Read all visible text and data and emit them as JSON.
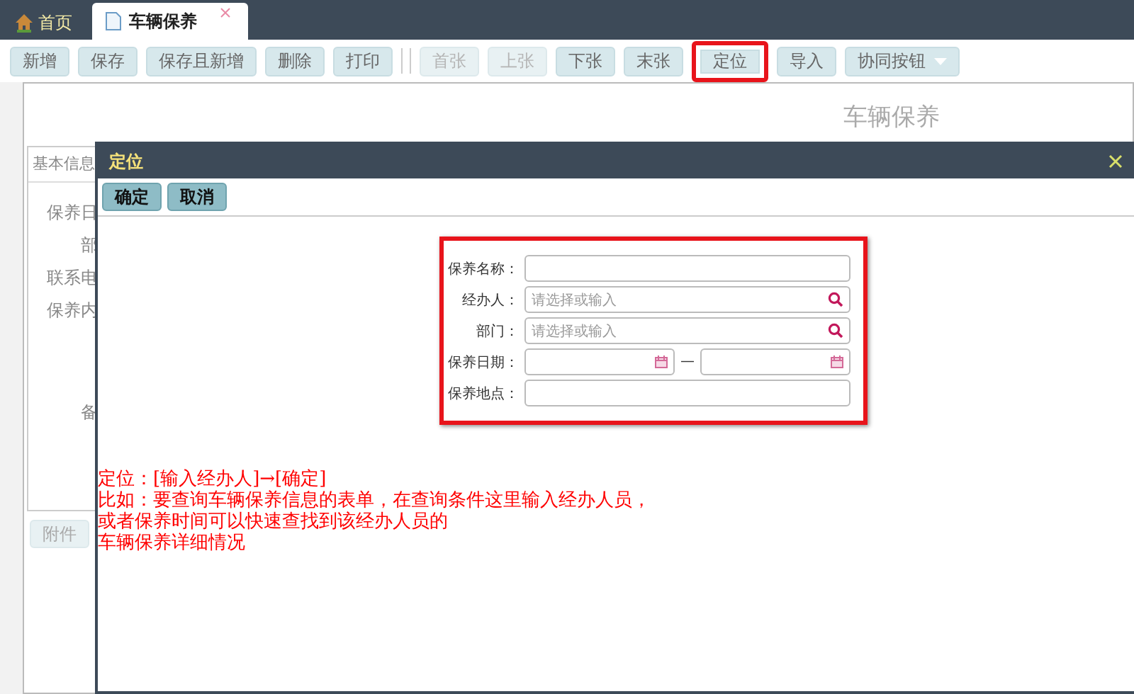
{
  "tabs": [
    {
      "label": "首页",
      "kind": "home",
      "selected": false,
      "closable": false
    },
    {
      "label": "车辆保养",
      "kind": "document",
      "selected": true,
      "closable": true
    }
  ],
  "toolbar": [
    {
      "label": "新增",
      "kind": "button",
      "disabled": false,
      "highlighted": false
    },
    {
      "label": "保存",
      "kind": "button",
      "disabled": false,
      "highlighted": false
    },
    {
      "label": "保存且新增",
      "kind": "button",
      "disabled": false,
      "highlighted": false
    },
    {
      "label": "删除",
      "kind": "button",
      "disabled": false,
      "highlighted": false
    },
    {
      "label": "打印",
      "kind": "button",
      "disabled": false,
      "highlighted": false
    },
    {
      "kind": "separator"
    },
    {
      "label": "首张",
      "kind": "button",
      "disabled": true,
      "highlighted": false
    },
    {
      "label": "上张",
      "kind": "button",
      "disabled": true,
      "highlighted": false
    },
    {
      "label": "下张",
      "kind": "button",
      "disabled": false,
      "highlighted": false
    },
    {
      "label": "末张",
      "kind": "button",
      "disabled": false,
      "highlighted": false
    },
    {
      "label": "定位",
      "kind": "button",
      "disabled": false,
      "highlighted": true
    },
    {
      "label": "导入",
      "kind": "button",
      "disabled": false,
      "highlighted": false
    },
    {
      "label": "协同按钮",
      "kind": "dropdown",
      "disabled": false,
      "highlighted": false
    }
  ],
  "form": {
    "title": "车辆保养",
    "section": "基本信息",
    "labels": [
      {
        "text": "保养日",
        "tall": false
      },
      {
        "text": "部",
        "tall": false
      },
      {
        "text": "联系电",
        "tall": false
      },
      {
        "text": "保养内",
        "tall": true
      },
      {
        "text": "备",
        "tall": false
      }
    ],
    "attachment_button": "附件"
  },
  "dialog": {
    "title": "定位",
    "buttons": [
      "确定",
      "取消"
    ],
    "fields": [
      {
        "label": "保养名称：",
        "kind": "text"
      },
      {
        "label": "经办人：",
        "kind": "lookup",
        "placeholder": "请选择或输入"
      },
      {
        "label": "部门：",
        "kind": "lookup",
        "placeholder": "请选择或输入"
      },
      {
        "label": "保养日期：",
        "kind": "daterange",
        "separator": "—"
      },
      {
        "label": "保养地点：",
        "kind": "text"
      }
    ],
    "note": [
      "定位：[输入经办人]→[确定]",
      "比如：要查询车辆保养信息的表单，在查询条件这里输入经办人员，",
      "或者保养时间可以快速查找到该经办人员的",
      "车辆保养详细情况"
    ]
  }
}
